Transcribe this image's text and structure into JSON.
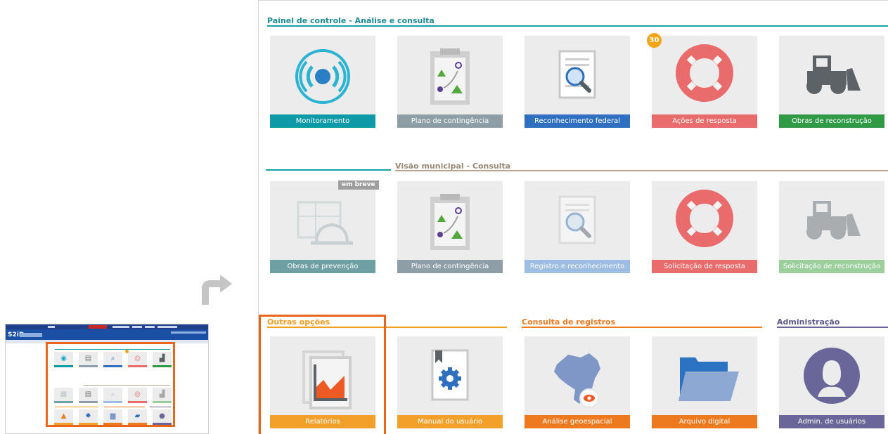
{
  "thumbnail": {
    "app_logo": "S2iD",
    "icon": "s2id-dashboard-thumbnail"
  },
  "sections": {
    "control_panel": "Painel de controle - Análise e consulta",
    "municipal": "Visão municipal - Consulta",
    "other_options": "Outras opções",
    "records": "Consulta de registros",
    "admin": "Administração"
  },
  "control_panel_tiles": [
    {
      "label": "Monitoramento",
      "color": "#0e9aa7",
      "icon": "signal-icon"
    },
    {
      "label": "Plano de contingência",
      "color": "#8e9ea7",
      "icon": "clipboard-map-icon"
    },
    {
      "label": "Reconhecimento federal",
      "color": "#2f6fbf",
      "icon": "document-search-icon"
    },
    {
      "label": "Ações de resposta",
      "color": "#ea6b6b",
      "icon": "lifebuoy-icon",
      "badge": "30"
    },
    {
      "label": "Obras de reconstrução",
      "color": "#2f9a46",
      "icon": "bulldozer-icon"
    }
  ],
  "municipal_tiles": [
    {
      "label": "Obras de prevenção",
      "color": "#6e9fa3",
      "icon": "hardhat-blueprint-icon",
      "tag": "em breve"
    },
    {
      "label": "Plano de contingência",
      "color": "#8e9ea7",
      "icon": "clipboard-map-icon"
    },
    {
      "label": "Registro e reconhecimento",
      "color": "#9dbde3",
      "icon": "document-search-icon"
    },
    {
      "label": "Solicitação de resposta",
      "color": "#ea6b6b",
      "icon": "lifebuoy-icon"
    },
    {
      "label": "Solicitação de reconstrução",
      "color": "#9ccf9c",
      "icon": "bulldozer-icon"
    }
  ],
  "bottom_tiles": [
    {
      "label": "Relatórios",
      "color": "#f3a02a",
      "icon": "chart-report-icon"
    },
    {
      "label": "Manual do usuário",
      "color": "#f3a02a",
      "icon": "manual-gear-icon"
    },
    {
      "label": "Análise geoespacial",
      "color": "#ee7a1f",
      "icon": "brazil-map-icon"
    },
    {
      "label": "Arquivo digital",
      "color": "#ee7a1f",
      "icon": "folder-icon"
    },
    {
      "label": "Admin. de usuários",
      "color": "#6a6699",
      "icon": "user-avatar-icon"
    }
  ],
  "colors": {
    "teal_line": "#1a9fa6",
    "tan_line": "#b5a590",
    "orange": "#ee7a1f",
    "orange_title": "#f39a1d",
    "admin_purple": "#6a6699",
    "highlight": "#e8651a",
    "badge": "#f5a416",
    "arrow": "#c5c5c5"
  }
}
